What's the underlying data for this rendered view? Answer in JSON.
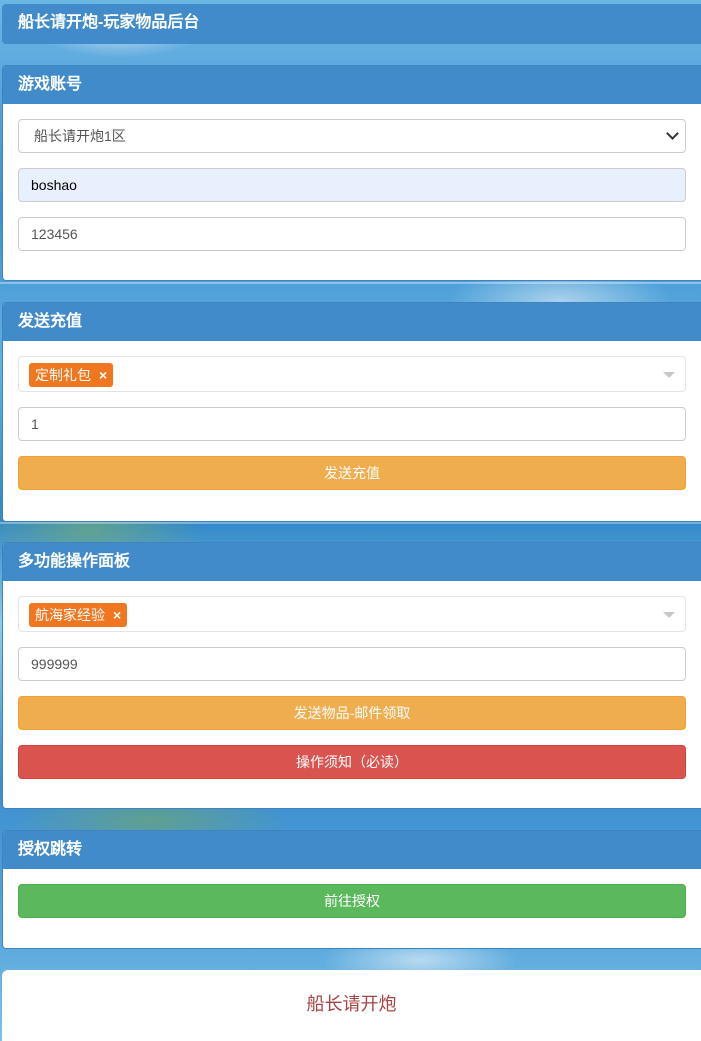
{
  "header": {
    "title": "船长请开炮-玩家物品后台"
  },
  "account_panel": {
    "title": "游戏账号",
    "server_select": "船长请开炮1区",
    "username": "boshao",
    "password": "123456"
  },
  "recharge_panel": {
    "title": "发送充值",
    "selected_tag": "定制礼包",
    "quantity": "1",
    "submit_label": "发送充值"
  },
  "multi_panel": {
    "title": "多功能操作面板",
    "selected_tag": "航海家经验",
    "quantity": "999999",
    "send_label": "发送物品-邮件领取",
    "notice_label": "操作须知（必读）"
  },
  "auth_panel": {
    "title": "授权跳转",
    "go_label": "前往授权"
  },
  "footer": {
    "text": "船长请开炮"
  },
  "icons": {
    "remove_tag": "×"
  },
  "colors": {
    "primary": "#428bca",
    "warning": "#f0ad4e",
    "danger": "#d9534f",
    "success": "#5cb85c",
    "tag": "#f0761f",
    "footer_text": "#a94442"
  }
}
